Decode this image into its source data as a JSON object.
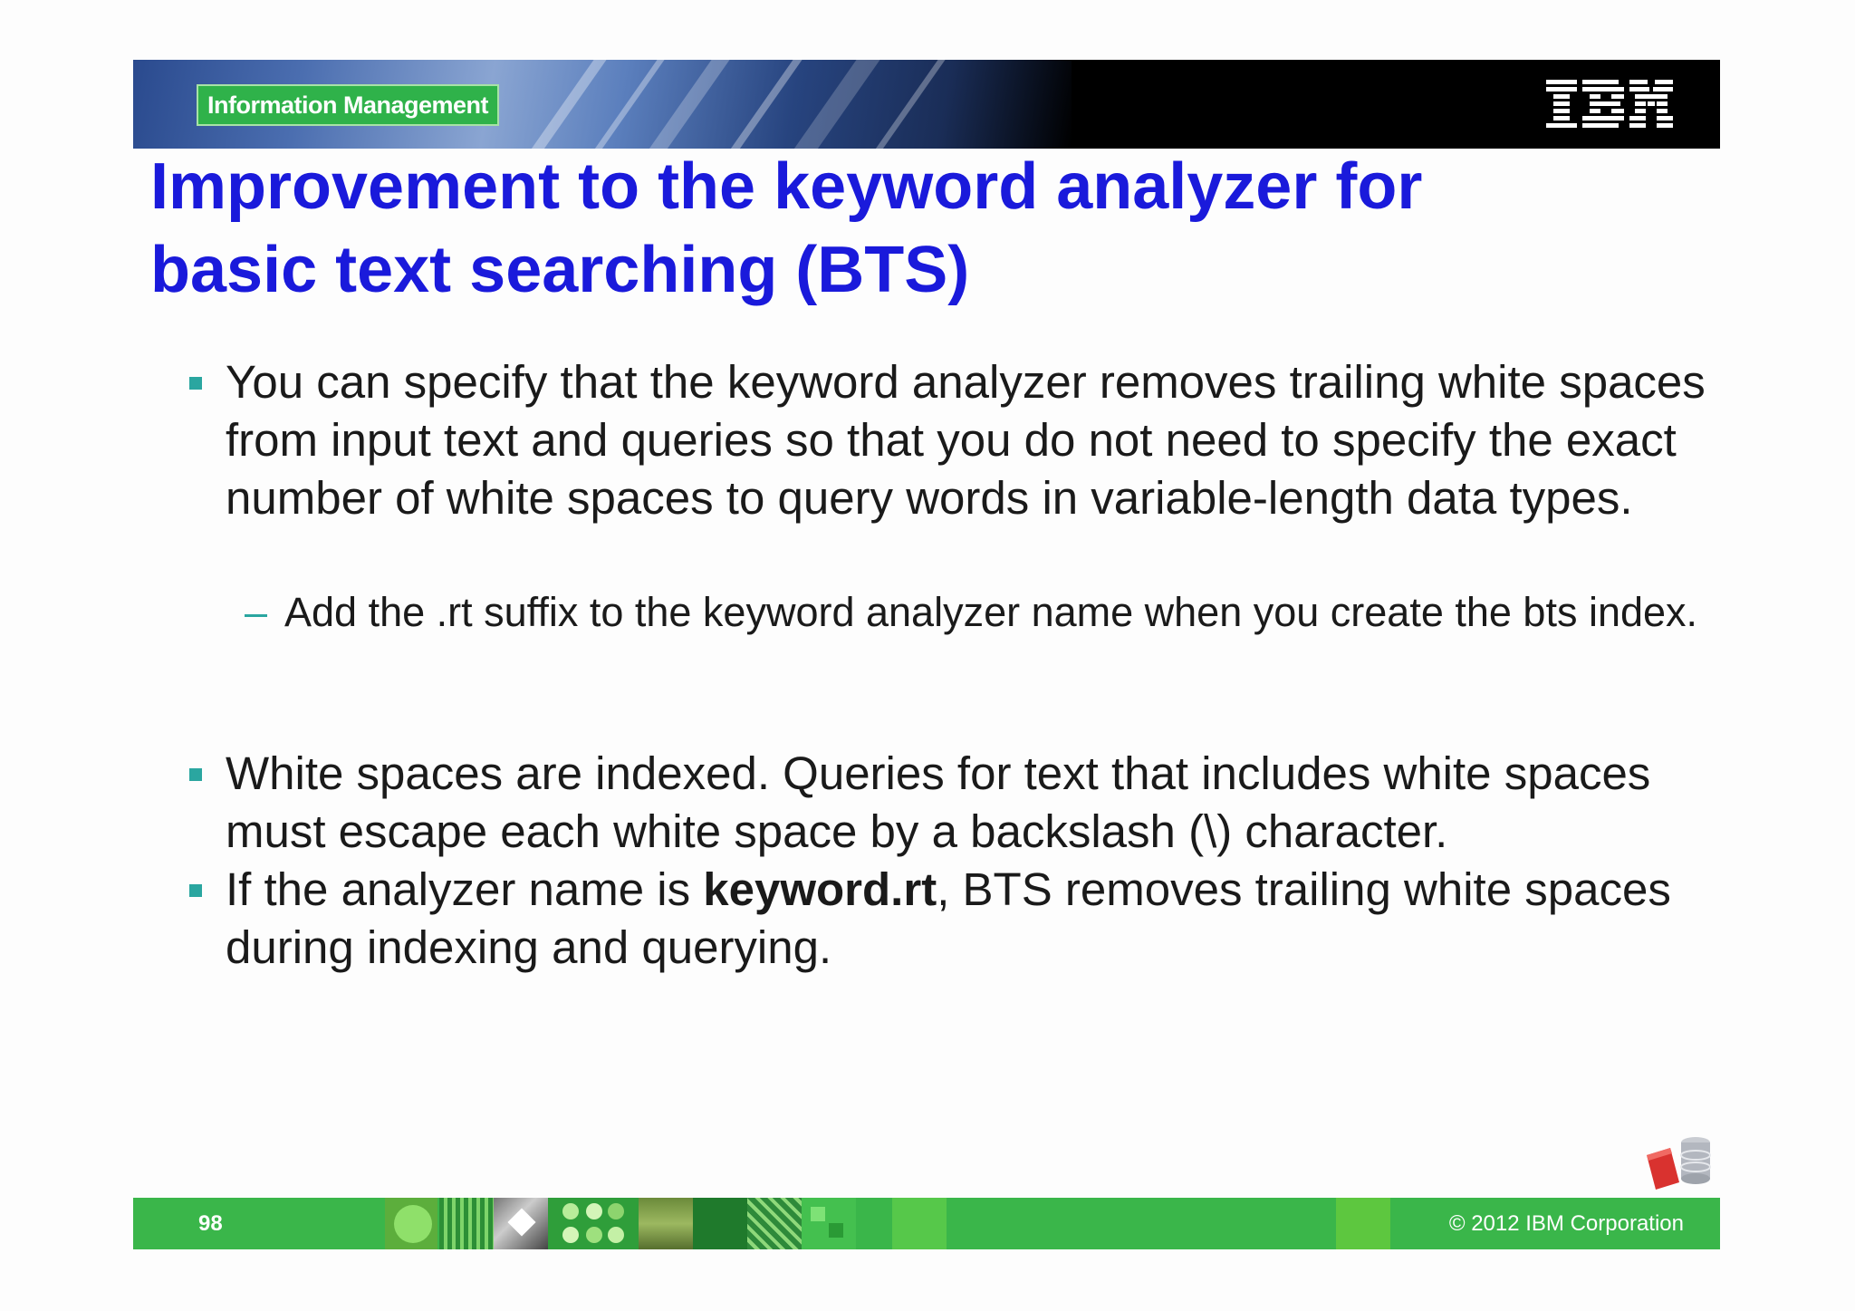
{
  "header": {
    "brand_label": "Information Management",
    "logo_name": "ibm-logo"
  },
  "title": {
    "line1": "Improvement to the keyword analyzer for",
    "line2": "basic text searching (BTS)"
  },
  "bullets": [
    {
      "text": "You can specify that the keyword analyzer removes trailing white spaces from input text and queries so that you do not need to specify the exact number of white spaces to query words in variable-length data types.",
      "sub": "Add the .rt suffix to the keyword analyzer name when you create the bts index."
    },
    {
      "text": "White spaces are indexed. Queries for text that includes white spaces must escape each white space by a backslash (\\) character."
    },
    {
      "prefix": "If the analyzer name is ",
      "bold": "keyword.rt",
      "suffix": ", BTS removes trailing white spaces during indexing and querying."
    }
  ],
  "footer": {
    "page_number": "98",
    "copyright": "© 2012 IBM Corporation"
  },
  "colors": {
    "title": "#1a1adb",
    "bullet_marker": "#2aa6a0",
    "footer": "#3ab64a",
    "brand_pill": "#2fb24a"
  }
}
